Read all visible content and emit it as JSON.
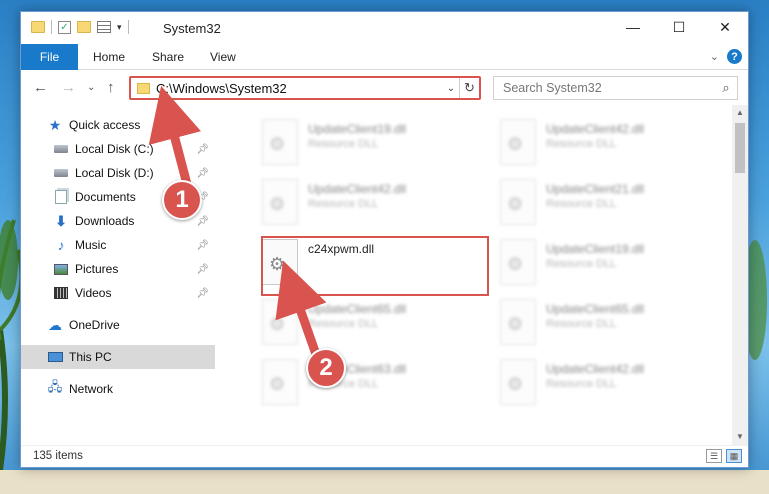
{
  "window": {
    "title": "System32"
  },
  "ribbon": {
    "file": "File",
    "home": "Home",
    "share": "Share",
    "view": "View",
    "help": "?"
  },
  "address": {
    "path": "C:\\Windows\\System32",
    "refresh": "↻",
    "dropdown": "⌄"
  },
  "search": {
    "placeholder": "Search System32"
  },
  "nav": {
    "items": [
      {
        "label": "Quick access",
        "icon": "quick-access-star-icon"
      },
      {
        "label": "Local Disk (C:)",
        "icon": "drive-icon",
        "pinned": true
      },
      {
        "label": "Local Disk (D:)",
        "icon": "drive-icon",
        "pinned": true
      },
      {
        "label": "Documents",
        "icon": "documents-icon",
        "pinned": true
      },
      {
        "label": "Downloads",
        "icon": "downloads-icon",
        "pinned": true
      },
      {
        "label": "Music",
        "icon": "music-icon",
        "pinned": true
      },
      {
        "label": "Pictures",
        "icon": "pictures-icon",
        "pinned": true
      },
      {
        "label": "Videos",
        "icon": "videos-icon",
        "pinned": true
      },
      {
        "label": "OneDrive",
        "icon": "onedrive-icon"
      },
      {
        "label": "This PC",
        "icon": "this-pc-icon",
        "selected": true
      },
      {
        "label": "Network",
        "icon": "network-icon"
      }
    ]
  },
  "files": {
    "left": [
      {
        "name": "UpdateClient19.dll",
        "type": "Resource DLL"
      },
      {
        "name": "UpdateClient42.dll",
        "type": "Resource DLL"
      },
      {
        "name": "c24xpwm.dll",
        "type": ""
      },
      {
        "name": "UpdateClient65.dll",
        "type": "Resource DLL"
      },
      {
        "name": "UpdateClient63.dll",
        "type": "Resource DLL"
      }
    ],
    "right": [
      {
        "name": "UpdateClient42.dll",
        "type": "Resource DLL"
      },
      {
        "name": "UpdateClient21.dll",
        "type": "Resource DLL"
      },
      {
        "name": "UpdateClient19.dll",
        "type": "Resource DLL"
      },
      {
        "name": "UpdateClient65.dll",
        "type": "Resource DLL"
      },
      {
        "name": "UpdateClient42.dll",
        "type": "Resource DLL"
      }
    ]
  },
  "status": {
    "count": "135 items"
  },
  "annotations": {
    "step1": "1",
    "step2": "2",
    "color": "#d9534f"
  }
}
